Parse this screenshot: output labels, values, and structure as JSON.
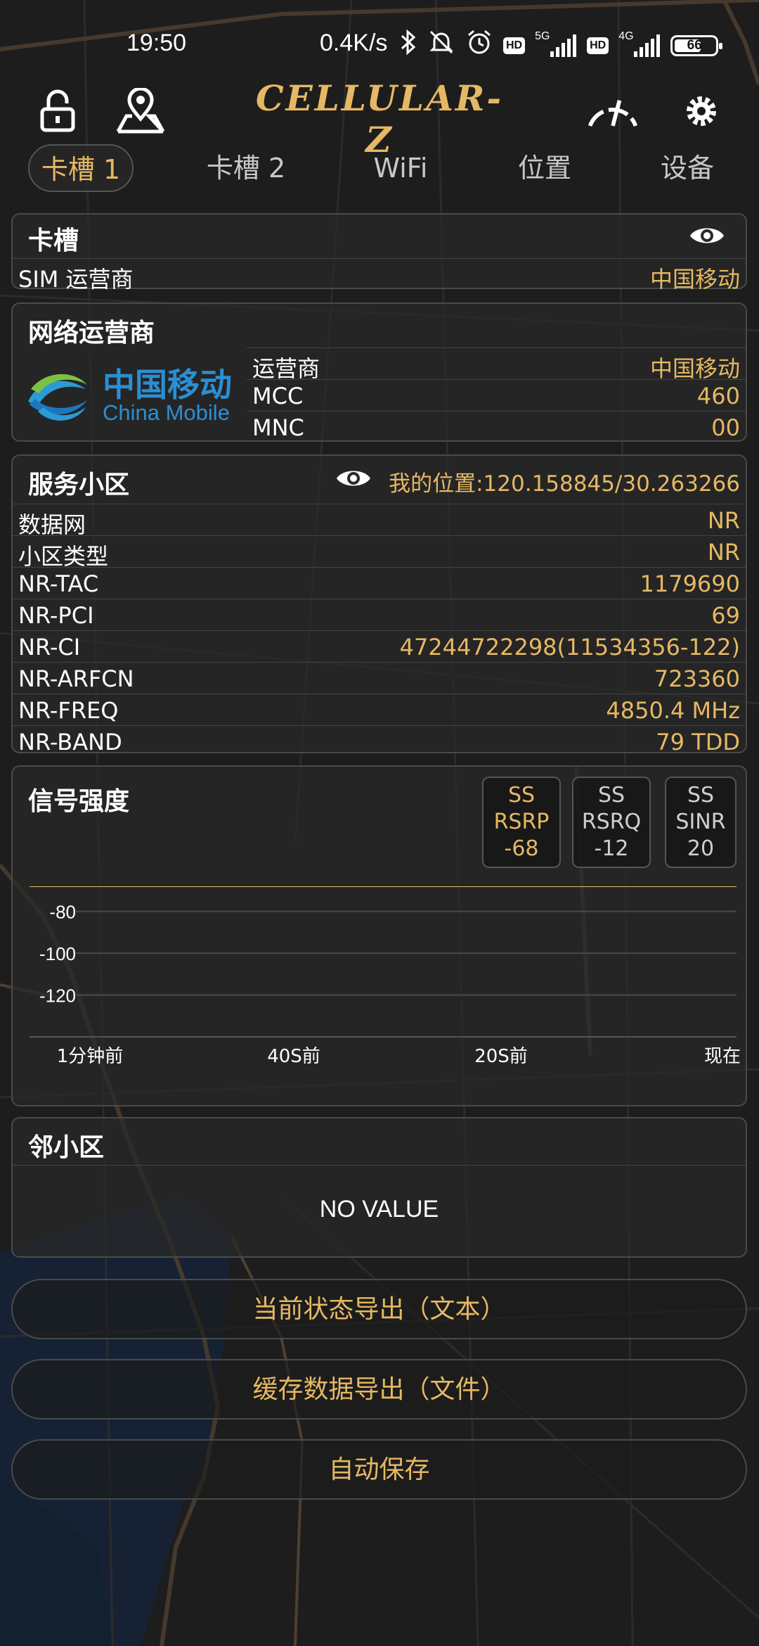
{
  "status_bar": {
    "time": "19:50",
    "speed": "0.4K/s",
    "net1": "5G",
    "net2": "4G",
    "hd": "HD",
    "battery": "66",
    "battery_level": 0.66
  },
  "header": {
    "logo": "CELLULAR-Z"
  },
  "tabs": [
    {
      "label": "卡槽 1",
      "active": true
    },
    {
      "label": "卡槽 2"
    },
    {
      "label": "WiFi"
    },
    {
      "label": "位置"
    },
    {
      "label": "设备"
    }
  ],
  "slot_card": {
    "title": "卡槽",
    "rows": [
      {
        "key": "SIM 运营商",
        "value": "中国移动"
      }
    ]
  },
  "operator_card": {
    "title": "网络运营商",
    "logo_cn": "中国移动",
    "logo_en": "China Mobile",
    "rows": [
      {
        "key": "运营商",
        "value": "中国移动"
      },
      {
        "key": "MCC",
        "value": "460"
      },
      {
        "key": "MNC",
        "value": "00"
      }
    ]
  },
  "serving_card": {
    "title": "服务小区",
    "location": "我的位置:120.158845/30.263266",
    "rows": [
      {
        "key": "数据网",
        "value": "NR"
      },
      {
        "key": "小区类型",
        "value": "NR"
      },
      {
        "key": "NR-TAC",
        "value": "1179690"
      },
      {
        "key": "NR-PCI",
        "value": "69"
      },
      {
        "key": "NR-CI",
        "value": "47244722298(11534356-122)"
      },
      {
        "key": "NR-ARFCN",
        "value": "723360"
      },
      {
        "key": "NR-FREQ",
        "value": "4850.4 MHz"
      },
      {
        "key": "NR-BAND",
        "value": "79 TDD"
      }
    ]
  },
  "signal_card": {
    "title": "信号强度",
    "badges": [
      {
        "line1": "SS",
        "line2": "RSRP",
        "value": "-68",
        "active": true
      },
      {
        "line1": "SS",
        "line2": "RSRQ",
        "value": "-12"
      },
      {
        "line1": "SS",
        "line2": "SINR",
        "value": "20"
      }
    ]
  },
  "chart_data": {
    "type": "line",
    "y_ticks": [
      "-80",
      "-100",
      "-120"
    ],
    "x_ticks": [
      "1分钟前",
      "40S前",
      "20S前",
      "现在"
    ],
    "series": [
      {
        "values": [
          -68,
          -68
        ]
      }
    ],
    "ylim": [
      -140,
      -68
    ],
    "colors": {
      "line": "#e6b863"
    }
  },
  "neighbor_card": {
    "title": "邻小区",
    "empty_text": "NO VALUE"
  },
  "buttons": {
    "export_text": "当前状态导出（文本）",
    "export_file": "缓存数据导出（文件）",
    "autosave": "自动保存"
  },
  "colors": {
    "accent": "#e6b863",
    "card_bg": "#282828",
    "border": "#4a4a4a"
  }
}
